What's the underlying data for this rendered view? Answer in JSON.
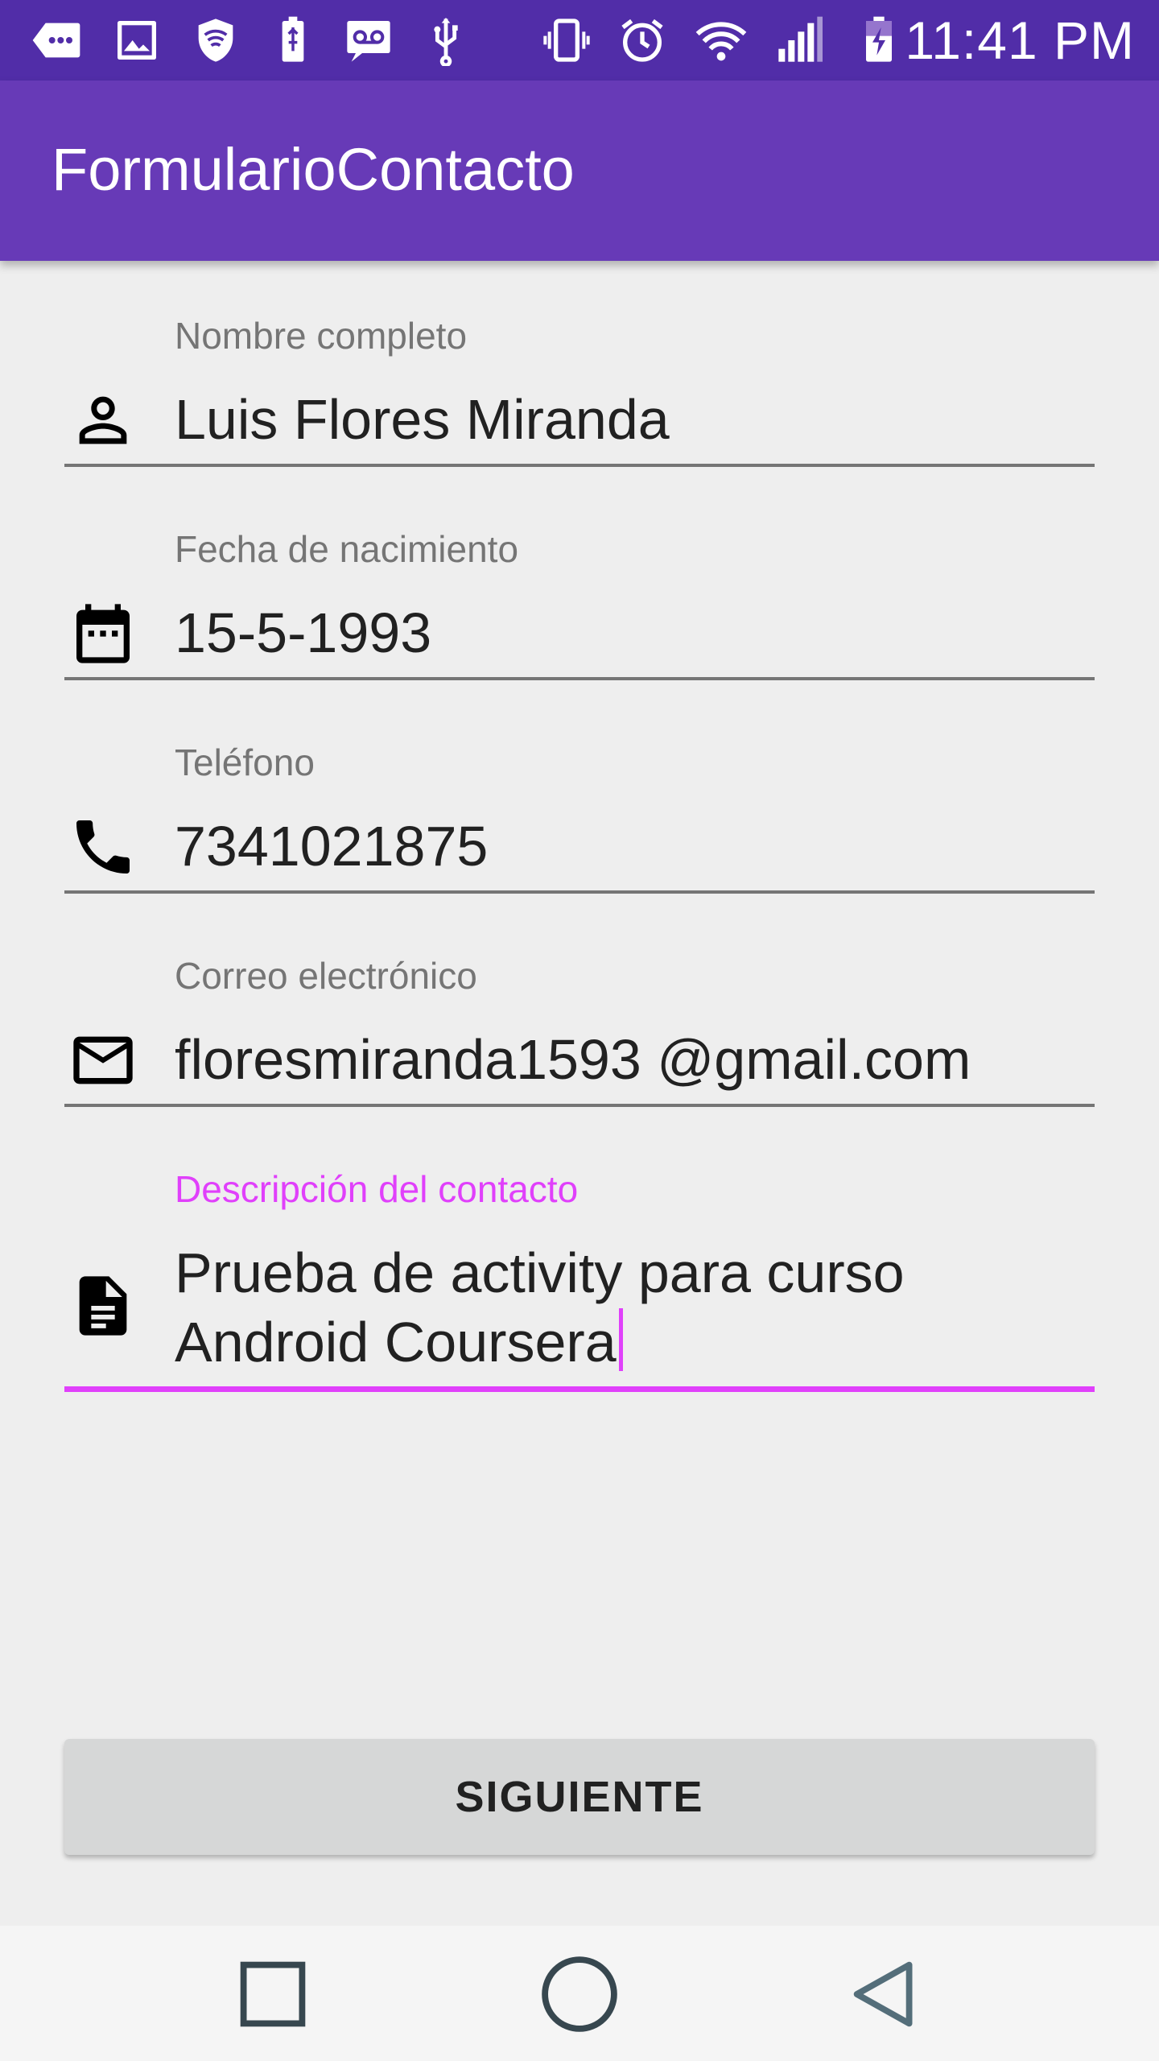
{
  "status_bar": {
    "time": "11:41 PM",
    "icons": [
      "more-notifications-icon",
      "gallery-icon",
      "vpn-shield-icon",
      "usb-battery-icon",
      "voicemail-icon",
      "usb-icon",
      "vibrate-icon",
      "alarm-icon",
      "wifi-icon",
      "signal-icon",
      "battery-charging-icon"
    ]
  },
  "app_bar": {
    "title": "FormularioContacto"
  },
  "form": {
    "fields": [
      {
        "label": "Nombre completo",
        "value": "Luis Flores Miranda",
        "icon": "person-icon"
      },
      {
        "label": "Fecha de nacimiento",
        "value": "15-5-1993",
        "icon": "calendar-icon"
      },
      {
        "label": "Teléfono",
        "value": "7341021875",
        "icon": "phone-icon"
      },
      {
        "label": "Correo electrónico",
        "value": "floresmiranda1593 @gmail.com",
        "icon": "email-icon"
      },
      {
        "label": "Descripción del contacto",
        "value": "Prueba de activity para curso Android Coursera",
        "icon": "document-icon"
      }
    ],
    "focused_field_index": 4
  },
  "button": {
    "label": "SIGUIENTE"
  },
  "nav_bar": {
    "buttons": [
      "recents-square-icon",
      "home-circle-icon",
      "back-triangle-icon"
    ]
  },
  "colors": {
    "status_bar": "#512da8",
    "app_bar": "#673ab7",
    "accent": "#e040fb",
    "background": "#eeeeee",
    "button": "#d6d7d7"
  }
}
